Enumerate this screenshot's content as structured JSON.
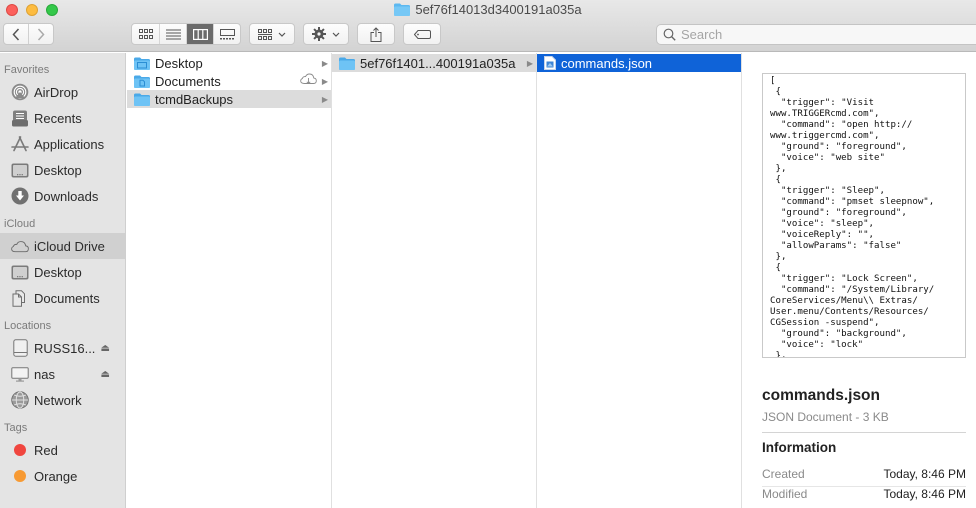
{
  "window": {
    "title": "5ef76f14013d3400191a035a",
    "title_icon": "folder-icon"
  },
  "toolbar": {
    "back_icon": "chevron-left-icon",
    "forward_icon": "chevron-right-icon",
    "view_modes": [
      "icon-view",
      "list-view",
      "column-view",
      "gallery-view"
    ],
    "active_view": "column-view",
    "group_icon": "group-by-icon",
    "action_icon": "gear-icon",
    "share_icon": "share-icon",
    "tag_icon": "tag-icon"
  },
  "search": {
    "placeholder": "Search",
    "value": ""
  },
  "sidebar": {
    "sections": [
      {
        "label": "Favorites",
        "items": [
          {
            "label": "AirDrop",
            "icon": "airdrop-icon"
          },
          {
            "label": "Recents",
            "icon": "recents-icon"
          },
          {
            "label": "Applications",
            "icon": "applications-icon"
          },
          {
            "label": "Desktop",
            "icon": "desktop-icon"
          },
          {
            "label": "Downloads",
            "icon": "downloads-icon"
          }
        ]
      },
      {
        "label": "iCloud",
        "items": [
          {
            "label": "iCloud Drive",
            "icon": "cloud-icon",
            "selected": true
          },
          {
            "label": "Desktop",
            "icon": "desktop-icon"
          },
          {
            "label": "Documents",
            "icon": "documents-icon"
          }
        ]
      },
      {
        "label": "Locations",
        "items": [
          {
            "label": "RUSS16...",
            "icon": "disk-icon",
            "eject": true
          },
          {
            "label": "nas",
            "icon": "monitor-icon",
            "eject": true
          },
          {
            "label": "Network",
            "icon": "network-icon"
          }
        ]
      },
      {
        "label": "Tags",
        "items": [
          {
            "label": "Red",
            "color": "#f0463f"
          },
          {
            "label": "Orange",
            "color": "#f79a33"
          }
        ]
      }
    ]
  },
  "columns": [
    {
      "items": [
        {
          "label": "Desktop",
          "has_children": true
        },
        {
          "label": "Documents",
          "has_children": true,
          "cloud": true
        },
        {
          "label": "tcmdBackups",
          "has_children": true,
          "selected": true
        }
      ]
    },
    {
      "items": [
        {
          "label": "5ef76f1401...400191a035a",
          "has_children": true,
          "selected": true
        }
      ]
    },
    {
      "items": [
        {
          "label": "commands.json",
          "selected": true,
          "active": true
        }
      ]
    }
  ],
  "preview": {
    "content": "[\n {\n  \"trigger\": \"Visit\nwww.TRIGGERcmd.com\",\n  \"command\": \"open http://\nwww.triggercmd.com\",\n  \"ground\": \"foreground\",\n  \"voice\": \"web site\"\n },\n {\n  \"trigger\": \"Sleep\",\n  \"command\": \"pmset sleepnow\",\n  \"ground\": \"foreground\",\n  \"voice\": \"sleep\",\n  \"voiceReply\": \"\",\n  \"allowParams\": \"false\"\n },\n {\n  \"trigger\": \"Lock Screen\",\n  \"command\": \"/System/Library/\nCoreServices/Menu\\\\ Extras/\nUser.menu/Contents/Resources/\nCGSession -suspend\",\n  \"ground\": \"background\",\n  \"voice\": \"lock\"\n },",
    "filename": "commands.json",
    "kind": "JSON Document - 3 KB",
    "info_heading": "Information",
    "info": [
      {
        "key": "Created",
        "value": "Today, 8:46 PM"
      },
      {
        "key": "Modified",
        "value": "Today, 8:46 PM"
      }
    ]
  },
  "colors": {
    "selection_blue": "#0f63d8",
    "folder_blue": "#5cb8f0"
  }
}
